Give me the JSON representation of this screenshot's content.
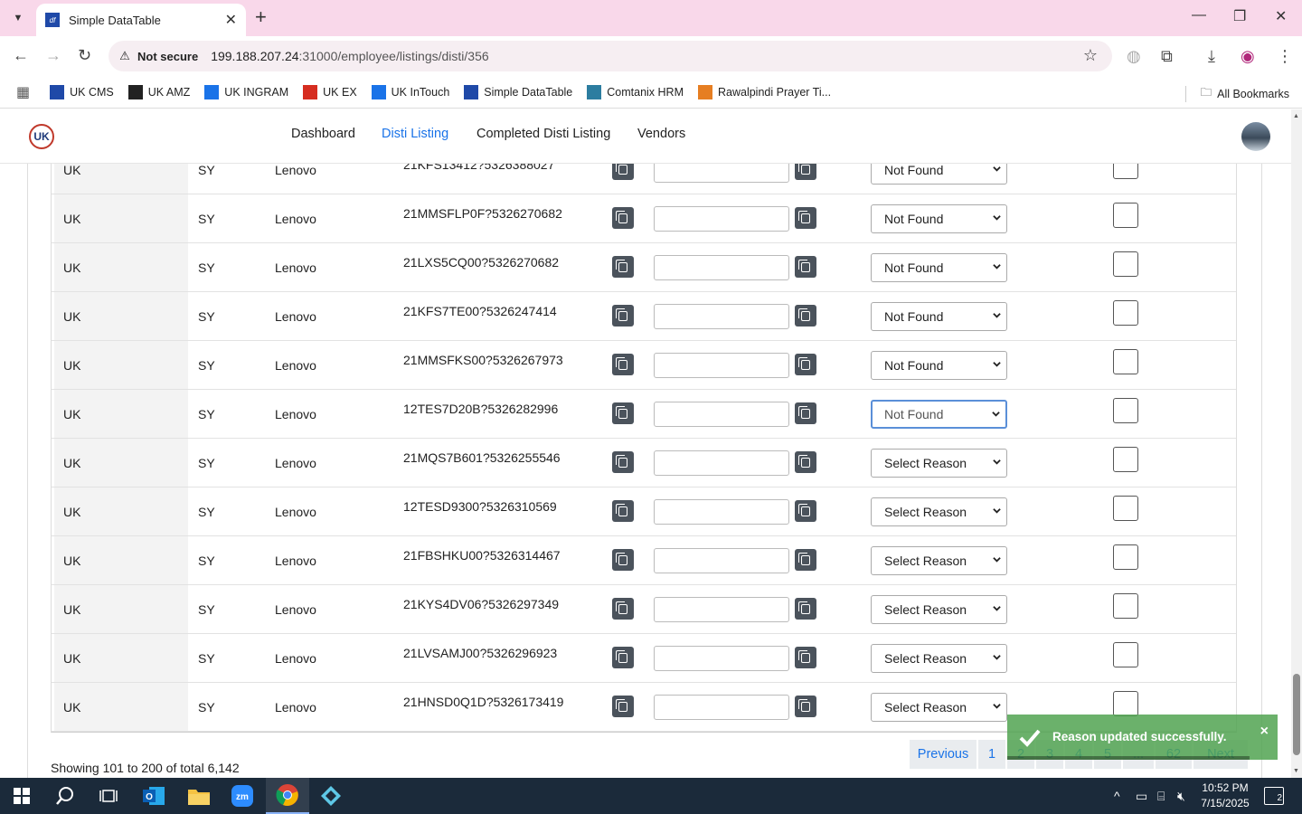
{
  "browser": {
    "tab_title": "Simple DataTable",
    "tab_favicon": "df",
    "not_secure_label": "Not secure",
    "url_host": "199.188.207.24",
    "url_path": ":31000/employee/listings/disti/356"
  },
  "bookmarks": {
    "items": [
      {
        "label": "UK CMS",
        "icon": "cms-icon",
        "color": "#1f49a8"
      },
      {
        "label": "UK AMZ",
        "icon": "amazon-icon",
        "color": "#222222"
      },
      {
        "label": "UK INGRAM",
        "icon": "ingram-icon",
        "color": "#1a73e8"
      },
      {
        "label": "UK EX",
        "icon": "ex-icon",
        "color": "#d62d20"
      },
      {
        "label": "UK InTouch",
        "icon": "intouch-icon",
        "color": "#1a73e8"
      },
      {
        "label": "Simple DataTable",
        "icon": "datatable-icon",
        "color": "#1f49a8"
      },
      {
        "label": "Comtanix HRM",
        "icon": "hrm-icon",
        "color": "#2c7da0"
      },
      {
        "label": "Rawalpindi Prayer Ti...",
        "icon": "prayer-icon",
        "color": "#e67e22"
      }
    ],
    "all_label": "All Bookmarks"
  },
  "nav": {
    "logo": "UK",
    "links": [
      "Dashboard",
      "Disti Listing",
      "Completed Disti Listing",
      "Vendors"
    ],
    "active": "Disti Listing"
  },
  "table": {
    "rows": [
      {
        "country": "UK",
        "code": "SY",
        "brand": "Lenovo",
        "sku": "21KFS13412?5326388027",
        "reason": "Not Found"
      },
      {
        "country": "UK",
        "code": "SY",
        "brand": "Lenovo",
        "sku": "21MMSFLP0F?5326270682",
        "reason": "Not Found"
      },
      {
        "country": "UK",
        "code": "SY",
        "brand": "Lenovo",
        "sku": "21LXS5CQ00?5326270682",
        "reason": "Not Found"
      },
      {
        "country": "UK",
        "code": "SY",
        "brand": "Lenovo",
        "sku": "21KFS7TE00?5326247414",
        "reason": "Not Found"
      },
      {
        "country": "UK",
        "code": "SY",
        "brand": "Lenovo",
        "sku": "21MMSFKS00?5326267973",
        "reason": "Not Found"
      },
      {
        "country": "UK",
        "code": "SY",
        "brand": "Lenovo",
        "sku": "12TES7D20B?5326282996",
        "reason": "Not Found",
        "focused": true
      },
      {
        "country": "UK",
        "code": "SY",
        "brand": "Lenovo",
        "sku": "21MQS7B601?5326255546",
        "reason": "Select Reason"
      },
      {
        "country": "UK",
        "code": "SY",
        "brand": "Lenovo",
        "sku": "12TESD9300?5326310569",
        "reason": "Select Reason"
      },
      {
        "country": "UK",
        "code": "SY",
        "brand": "Lenovo",
        "sku": "21FBSHKU00?5326314467",
        "reason": "Select Reason"
      },
      {
        "country": "UK",
        "code": "SY",
        "brand": "Lenovo",
        "sku": "21KYS4DV06?5326297349",
        "reason": "Select Reason"
      },
      {
        "country": "UK",
        "code": "SY",
        "brand": "Lenovo",
        "sku": "21LVSAMJ00?5326296923",
        "reason": "Select Reason"
      },
      {
        "country": "UK",
        "code": "SY",
        "brand": "Lenovo",
        "sku": "21HNSD0Q1D?5326173419",
        "reason": "Select Reason"
      }
    ]
  },
  "footer": {
    "showing": "Showing 101 to 200 of total 6,142",
    "pages": [
      "Previous",
      "1",
      "2",
      "3",
      "4",
      "5",
      "...",
      "62",
      "Next"
    ]
  },
  "toast": {
    "message": "Reason updated successfully.",
    "close": "×",
    "color": "#51a351"
  },
  "taskbar": {
    "time": "10:52 PM",
    "date": "7/15/2025",
    "notifications": "2"
  }
}
